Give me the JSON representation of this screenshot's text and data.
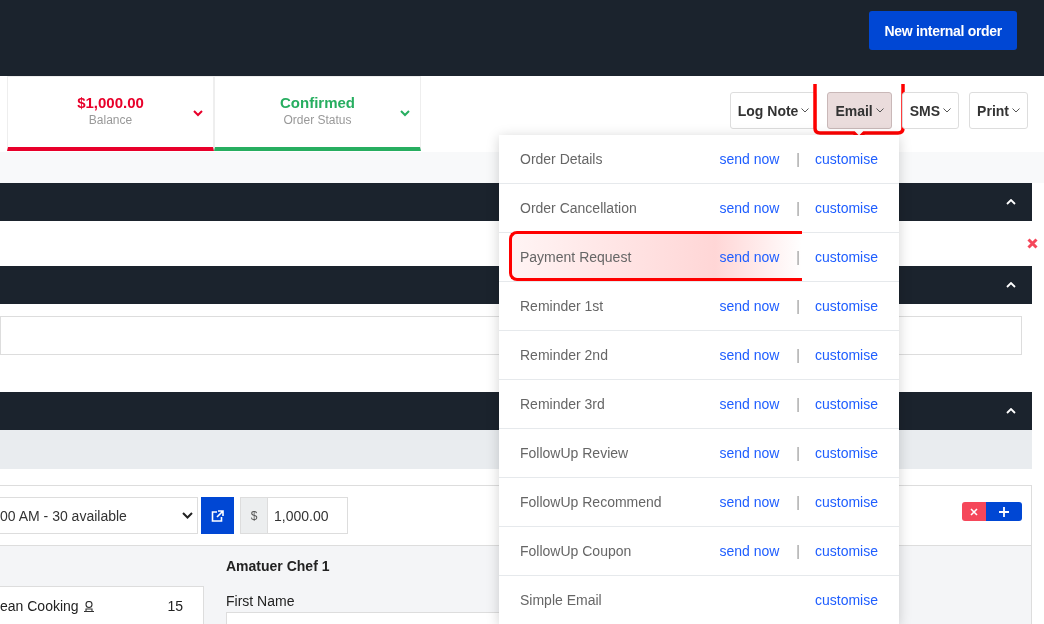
{
  "header": {
    "button": "New internal order"
  },
  "stats": [
    {
      "value": "$1,000.00",
      "label": "Balance",
      "color": "#e8002a"
    },
    {
      "value": "Confirmed",
      "label": "Order Status",
      "color": "#27ae60"
    }
  ],
  "actions": [
    {
      "label": "Log Note",
      "selected": false,
      "annotated": false
    },
    {
      "label": "Email",
      "selected": true,
      "annotated": true
    },
    {
      "label": "SMS",
      "selected": false,
      "annotated": false
    },
    {
      "label": "Print",
      "selected": false,
      "annotated": false
    }
  ],
  "email_menu": [
    {
      "name": "Order Details",
      "send_now": "send now",
      "separator": "|",
      "customise": "customise",
      "highlighted": false
    },
    {
      "name": "Order Cancellation",
      "send_now": "send now",
      "separator": "|",
      "customise": "customise",
      "highlighted": false
    },
    {
      "name": "Payment Request",
      "send_now": "send now",
      "separator": "|",
      "customise": "customise",
      "highlighted": true
    },
    {
      "name": "Reminder 1st",
      "send_now": "send now",
      "separator": "|",
      "customise": "customise",
      "highlighted": false
    },
    {
      "name": "Reminder 2nd",
      "send_now": "send now",
      "separator": "|",
      "customise": "customise",
      "highlighted": false
    },
    {
      "name": "Reminder 3rd",
      "send_now": "send now",
      "separator": "|",
      "customise": "customise",
      "highlighted": false
    },
    {
      "name": "FollowUp Review",
      "send_now": "send now",
      "separator": "|",
      "customise": "customise",
      "highlighted": false
    },
    {
      "name": "FollowUp Recommend",
      "send_now": "send now",
      "separator": "|",
      "customise": "customise",
      "highlighted": false
    },
    {
      "name": "FollowUp Coupon",
      "send_now": "send now",
      "separator": "|",
      "customise": "customise",
      "highlighted": false
    },
    {
      "name": "Simple Email",
      "customise": "customise",
      "highlighted": false
    }
  ],
  "sections": [
    {
      "expanded": true
    },
    {
      "expanded": true
    },
    {
      "expanded": true
    }
  ],
  "booking": {
    "slot": "00 AM - 30 available",
    "currency": "$",
    "amount": "1,000.00"
  },
  "class_item": {
    "name": "ean Cooking",
    "count": "15"
  },
  "attendee": {
    "title": "Amatuer Chef 1",
    "first_name_label": "First Name"
  }
}
